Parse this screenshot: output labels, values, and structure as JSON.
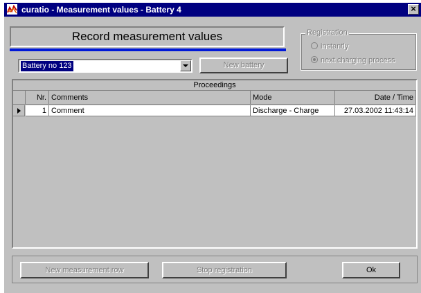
{
  "window": {
    "title": "curatio - Measurement values - Battery 4",
    "close_glyph": "×"
  },
  "header": {
    "title": "Record measurement values"
  },
  "battery_select": {
    "value": "Battery no 123"
  },
  "new_battery_button": {
    "label": "New battery"
  },
  "registration": {
    "legend": "Registration",
    "options": [
      {
        "label": "instantly",
        "selected": false
      },
      {
        "label": "next charging process",
        "selected": true
      }
    ]
  },
  "proceedings": {
    "caption": "Proceedings",
    "columns": {
      "nr": "Nr.",
      "comments": "Comments",
      "mode": "Mode",
      "datetime": "Date / Time"
    },
    "rows": [
      {
        "nr": "1",
        "comments": "Comment",
        "mode": "Discharge - Charge",
        "datetime": "27.03.2002 11:43:14"
      }
    ]
  },
  "footer": {
    "new_measurement_row": "New measurement row",
    "stop_registration": "Stop registration",
    "ok": "Ok"
  },
  "colors": {
    "titlebar": "#000080",
    "accent_line": "#0018d8",
    "face": "#c0c0c0"
  }
}
